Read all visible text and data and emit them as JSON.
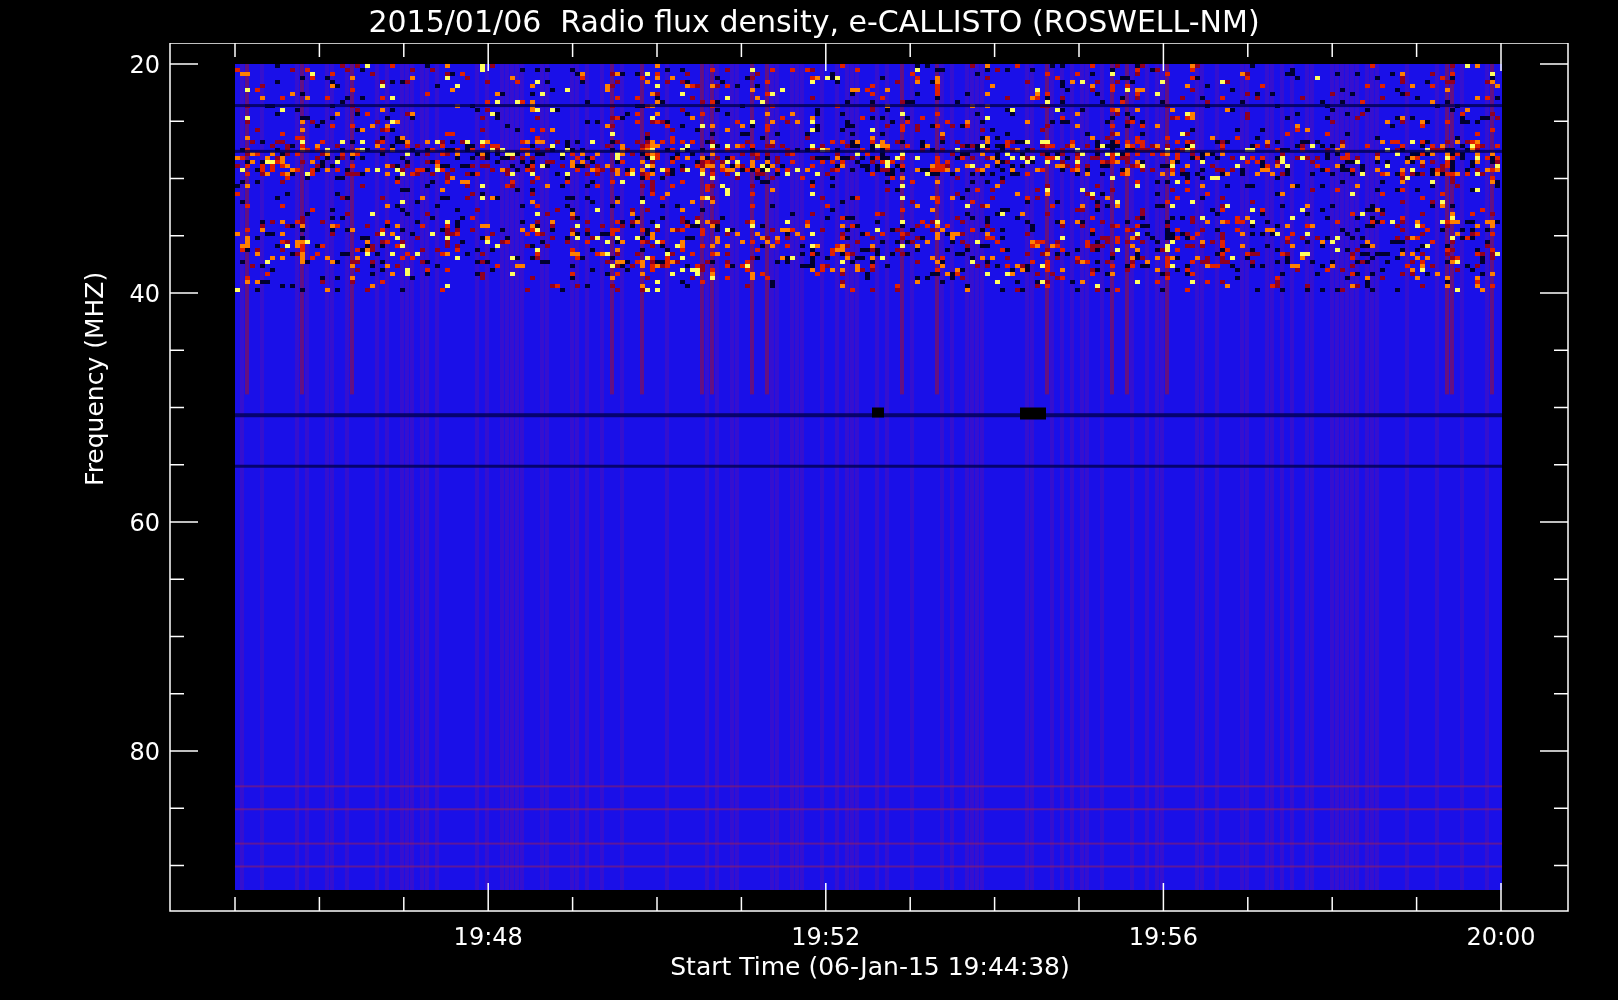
{
  "title": "2015/01/06  Radio flux density, e-CALLISTO (ROSWELL-NM)",
  "y_axis": {
    "label": "Frequency (MHZ)",
    "ticks": [
      "20",
      "40",
      "60",
      "80"
    ]
  },
  "x_axis": {
    "label": "Start Time (06-Jan-15 19:44:38)",
    "ticks": [
      "19:48",
      "19:52",
      "19:56",
      "20:00"
    ]
  }
}
